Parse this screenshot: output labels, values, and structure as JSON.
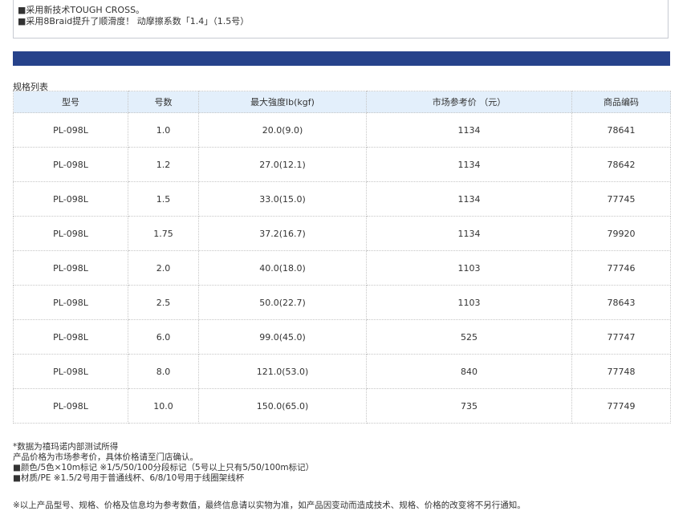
{
  "features": [
    "■采用新技术TOUGH CROSS。",
    "■采用8Braid提升了顺滑度！ 动摩擦系数「1.4」（1.5号）"
  ],
  "spec_title": "规格列表",
  "table": {
    "headers": [
      "型号",
      "号数",
      "最大強度lb(kgf)",
      "市场参考价 （元）",
      "商品编码"
    ],
    "rows": [
      [
        "PL-098L",
        "1.0",
        "20.0(9.0)",
        "1134",
        "78641"
      ],
      [
        "PL-098L",
        "1.2",
        "27.0(12.1)",
        "1134",
        "78642"
      ],
      [
        "PL-098L",
        "1.5",
        "33.0(15.0)",
        "1134",
        "77745"
      ],
      [
        "PL-098L",
        "1.75",
        "37.2(16.7)",
        "1134",
        "79920"
      ],
      [
        "PL-098L",
        "2.0",
        "40.0(18.0)",
        "1103",
        "77746"
      ],
      [
        "PL-098L",
        "2.5",
        "50.0(22.7)",
        "1103",
        "78643"
      ],
      [
        "PL-098L",
        "6.0",
        "99.0(45.0)",
        "525",
        "77747"
      ],
      [
        "PL-098L",
        "8.0",
        "121.0(53.0)",
        "840",
        "77748"
      ],
      [
        "PL-098L",
        "10.0",
        "150.0(65.0)",
        "735",
        "77749"
      ]
    ]
  },
  "notes": [
    "*数据为禧玛诺内部测试所得",
    "产品价格为市场参考价，具体价格请至门店确认。",
    "■颜色/5色×10m标记 ※1/5/50/100分段标记（5号以上只有5/50/100m标记）",
    "■材质/PE ※1.5/2号用于普通线杯、6/8/10号用于线圈架线杯"
  ],
  "disclaimer": "※以上产品型号、规格、价格及信息均为参考数值，最终信息请以实物为准，如产品因变动而造成技术、规格、价格的改变将不另行通知。",
  "colors": {
    "bar": "#26428b",
    "header_bg": "#e3effb"
  }
}
